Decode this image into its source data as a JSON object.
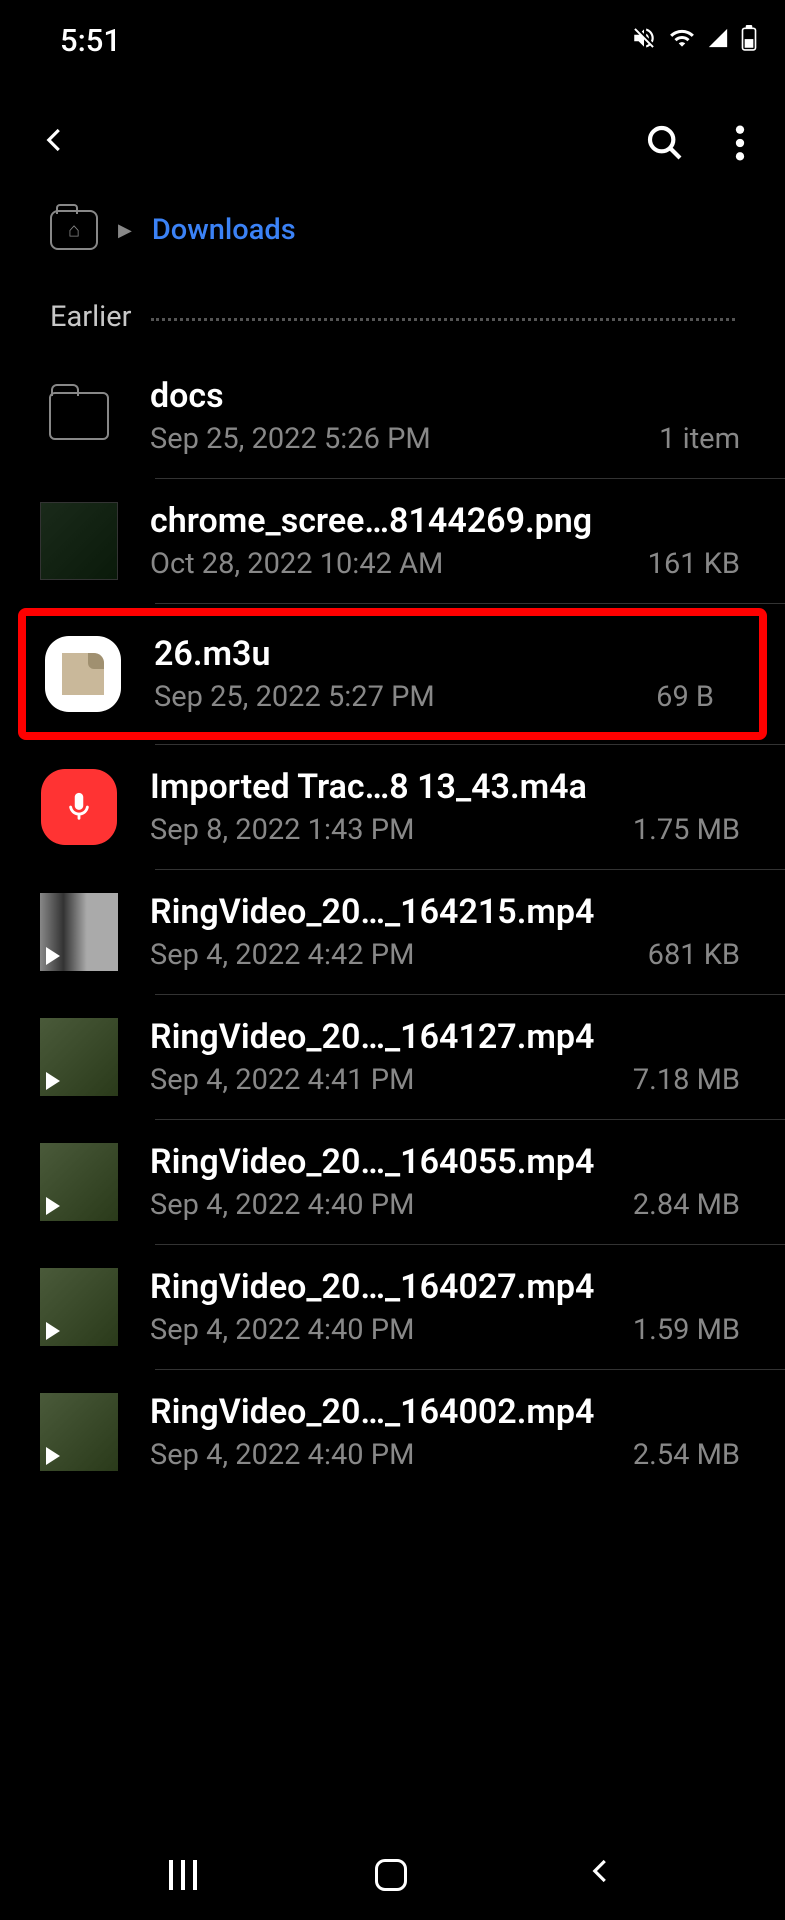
{
  "status": {
    "time": "5:51"
  },
  "breadcrumb": {
    "current": "Downloads"
  },
  "section": {
    "label": "Earlier"
  },
  "files": [
    {
      "name": "docs",
      "date": "Sep 25, 2022 5:26 PM",
      "size": "1 item",
      "type": "folder"
    },
    {
      "name": "chrome_scree…8144269.png",
      "date": "Oct 28, 2022 10:42 AM",
      "size": "161 KB",
      "type": "image"
    },
    {
      "name": "26.m3u",
      "date": "Sep 25, 2022 5:27 PM",
      "size": "69 B",
      "type": "file",
      "highlighted": true
    },
    {
      "name": "Imported Trac…8 13_43.m4a",
      "date": "Sep 8, 2022 1:43 PM",
      "size": "1.75 MB",
      "type": "audio"
    },
    {
      "name": "RingVideo_20…_164215.mp4",
      "date": "Sep 4, 2022 4:42 PM",
      "size": "681 KB",
      "type": "video"
    },
    {
      "name": "RingVideo_20…_164127.mp4",
      "date": "Sep 4, 2022 4:41 PM",
      "size": "7.18 MB",
      "type": "video"
    },
    {
      "name": "RingVideo_20…_164055.mp4",
      "date": "Sep 4, 2022 4:40 PM",
      "size": "2.84 MB",
      "type": "video"
    },
    {
      "name": "RingVideo_20…_164027.mp4",
      "date": "Sep 4, 2022 4:40 PM",
      "size": "1.59 MB",
      "type": "video"
    },
    {
      "name": "RingVideo_20…_164002.mp4",
      "date": "Sep 4, 2022 4:40 PM",
      "size": "2.54 MB",
      "type": "video"
    }
  ]
}
